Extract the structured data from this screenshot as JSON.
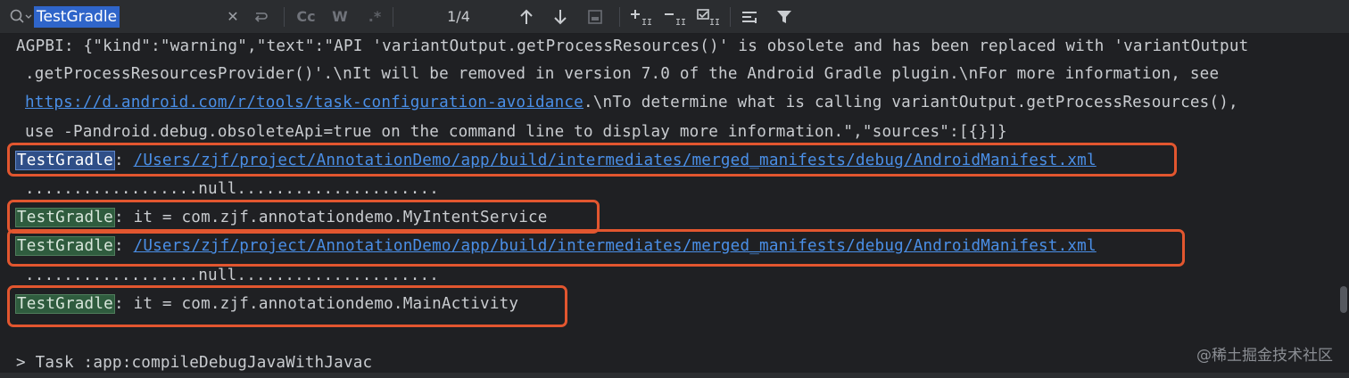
{
  "search": {
    "query": "TestGradle",
    "match_count": "1/4",
    "match_case_label": "Cc",
    "words_label": "W",
    "regex_label": ".*"
  },
  "console": {
    "line1": "AGPBI: {\"kind\":\"warning\",\"text\":\"API 'variantOutput.getProcessResources()' is obsolete and has been replaced with 'variantOutput",
    "line2": ".getProcessResourcesProvider()'.\\nIt will be removed in version 7.0 of the Android Gradle plugin.\\nFor more information, see",
    "line3_link": "https://d.android.com/r/tools/task-configuration-avoidance",
    "line3_rest": ".\\nTo determine what is calling variantOutput.getProcessResources(),",
    "line4": "use -Pandroid.debug.obsoleteApi=true on the command line to display more information.\",\"sources\":[{}]}",
    "tag": "TestGradle",
    "manifest_sep": ": ",
    "manifest_path": "/Users/zjf/project/AnnotationDemo/app/build/intermediates/merged_manifests/debug/AndroidManifest.xml",
    "null_line": "..................null.....................",
    "it_line_1": ": it = com.zjf.annotationdemo.MyIntentService",
    "it_line_2": ": it = com.zjf.annotationdemo.MainActivity",
    "task_line": "> Task :app:compileDebugJavaWithJavac"
  },
  "watermark": "@稀土掘金技术社区",
  "colors": {
    "highlight_box": "#e2562f",
    "link": "#4a8fe7",
    "current_match": "#2f4f88",
    "other_match": "#2f5c3e"
  },
  "icons": [
    "search-icon",
    "clear-icon",
    "replace-icon",
    "prev-match-icon",
    "next-match-icon",
    "select-all-icon",
    "add-selection-icon",
    "remove-selection-icon",
    "toggle-selection-icon",
    "filter-options-icon",
    "filter-icon"
  ]
}
